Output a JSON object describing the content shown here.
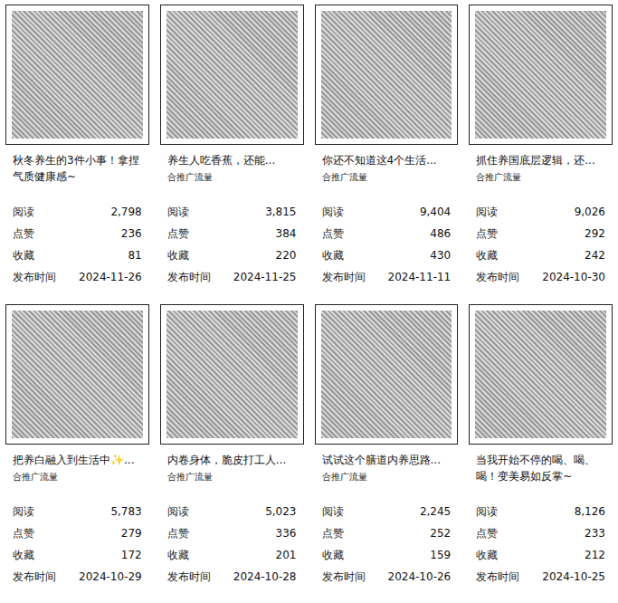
{
  "cards": [
    {
      "title": "秋冬养生的3件小事！拿捏气质健康感~",
      "stats": [
        {
          "label": "阅读",
          "value": "2,798"
        },
        {
          "label": "点赞",
          "value": "236"
        },
        {
          "label": "收藏",
          "value": "81"
        },
        {
          "label": "发布时间",
          "value": "2024-11-26"
        }
      ]
    },
    {
      "title": "养生人吃香蕉，还能...",
      "tag": "合推广流量",
      "stats": [
        {
          "label": "阅读",
          "value": "3,815"
        },
        {
          "label": "点赞",
          "value": "384"
        },
        {
          "label": "收藏",
          "value": "220"
        },
        {
          "label": "发布时间",
          "value": "2024-11-25"
        }
      ]
    },
    {
      "title": "你还不知道这4个生活...",
      "tag": "合推广流量",
      "stats": [
        {
          "label": "阅读",
          "value": "9,404"
        },
        {
          "label": "点赞",
          "value": "486"
        },
        {
          "label": "收藏",
          "value": "430"
        },
        {
          "label": "发布时间",
          "value": "2024-11-11"
        }
      ]
    },
    {
      "title": "抓住养国底层逻辑，还...",
      "tag": "合推广流量",
      "stats": [
        {
          "label": "阅读",
          "value": "9,026"
        },
        {
          "label": "点赞",
          "value": "292"
        },
        {
          "label": "收藏",
          "value": "242"
        },
        {
          "label": "发布时间",
          "value": "2024-10-30"
        }
      ]
    },
    {
      "title": "把养白融入到生活中✨...",
      "tag": "合推广流量",
      "stats": [
        {
          "label": "阅读",
          "value": "5,783"
        },
        {
          "label": "点赞",
          "value": "279"
        },
        {
          "label": "收藏",
          "value": "172"
        },
        {
          "label": "发布时间",
          "value": "2024-10-29"
        }
      ]
    },
    {
      "title": "内卷身体，脆皮打工人...",
      "tag": "合推广流量",
      "stats": [
        {
          "label": "阅读",
          "value": "5,023"
        },
        {
          "label": "点赞",
          "value": "336"
        },
        {
          "label": "收藏",
          "value": "201"
        },
        {
          "label": "发布时间",
          "value": "2024-10-28"
        }
      ]
    },
    {
      "title": "试试这个膳道内养思路...",
      "tag": "合推广流量",
      "stats": [
        {
          "label": "阅读",
          "value": "2,245"
        },
        {
          "label": "点赞",
          "value": "252"
        },
        {
          "label": "收藏",
          "value": "159"
        },
        {
          "label": "发布时间",
          "value": "2024-10-26"
        }
      ]
    },
    {
      "title": "当我开始不停的喝、喝、喝！变美易如反掌~",
      "stats": [
        {
          "label": "阅读",
          "value": "8,126"
        },
        {
          "label": "点赞",
          "value": "233"
        },
        {
          "label": "收藏",
          "value": "212"
        },
        {
          "label": "发布时间",
          "value": "2024-10-25"
        }
      ]
    }
  ]
}
